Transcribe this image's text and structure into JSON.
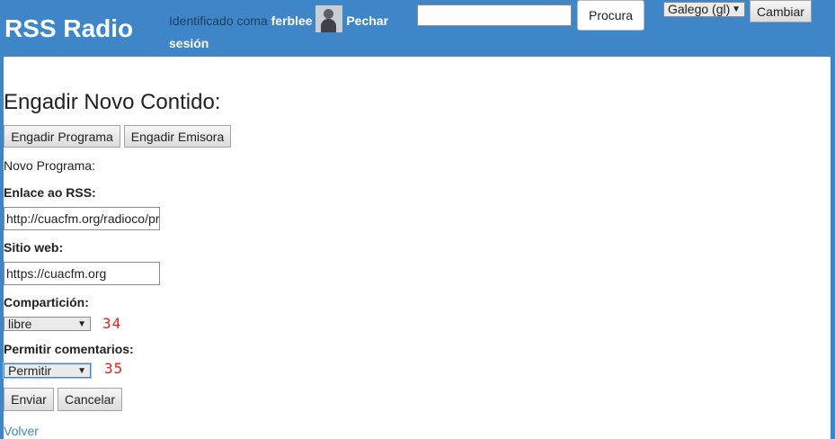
{
  "header": {
    "site_title": "RSS Radio",
    "identified_prefix": "Identificado coma",
    "username": "ferblee",
    "logout_label": "Pechar sesión",
    "search_value": "",
    "search_button": "Procura",
    "language_selected": "Galego (gl)",
    "change_button": "Cambiar"
  },
  "main": {
    "title": "Engadir Novo Contido:",
    "add_program_button": "Engadir Programa",
    "add_station_button": "Engadir Emisora",
    "section_label": "Novo Programa:",
    "rss_label": "Enlace ao RSS:",
    "rss_value": "http://cuacfm.org/radioco/pr",
    "website_label": "Sitio web:",
    "website_value": "https://cuacfm.org",
    "sharing_label": "Compartición:",
    "sharing_selected": "libre",
    "sharing_marker": "34",
    "comments_label": "Permitir comentarios:",
    "comments_selected": "Permitir",
    "comments_marker": "35",
    "submit_button": "Enviar",
    "cancel_button": "Cancelar",
    "back_link": "Volver"
  }
}
